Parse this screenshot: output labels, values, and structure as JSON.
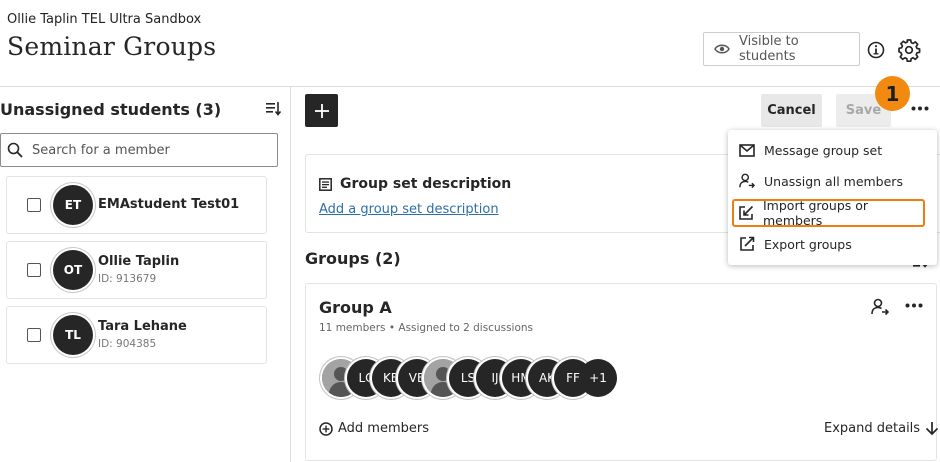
{
  "header": {
    "course_name": "Ollie Taplin TEL Ultra Sandbox",
    "page_title": "Seminar Groups",
    "visibility_label": "Visible to students"
  },
  "left_panel": {
    "title": "Unassigned students (3)",
    "search_placeholder": "Search for a member",
    "students": [
      {
        "initials": "ET",
        "name": "EMAstudent Test01",
        "id": ""
      },
      {
        "initials": "OT",
        "name": "Ollie Taplin",
        "id": "ID: 913679"
      },
      {
        "initials": "TL",
        "name": "Tara Lehane",
        "id": "ID: 904385"
      }
    ]
  },
  "toolbar": {
    "add_symbol": "+",
    "cancel_label": "Cancel",
    "save_label": "Save",
    "step_number": "1"
  },
  "menu": {
    "items": [
      {
        "label": "Message group set",
        "icon": "envelope-icon"
      },
      {
        "label": "Unassign all members",
        "icon": "unassign-user-icon"
      },
      {
        "label": "Import groups or members",
        "icon": "import-icon"
      },
      {
        "label": "Export groups",
        "icon": "export-icon"
      }
    ]
  },
  "description": {
    "title": "Group set description",
    "link": "Add a group set description"
  },
  "groups": {
    "title": "Groups (2)",
    "group_a": {
      "name": "Group A",
      "meta": "11 members  •  Assigned to 2 discussions",
      "members": [
        "",
        "LC",
        "KB",
        "VB",
        "",
        "LS",
        "IJ",
        "HM",
        "AK",
        "FF",
        "+1"
      ],
      "add_members_label": "Add members",
      "expand_label": "Expand details"
    }
  },
  "colors": {
    "accent_orange": "#f28a12",
    "link_blue": "#2d6fa6",
    "dark": "#262626"
  }
}
